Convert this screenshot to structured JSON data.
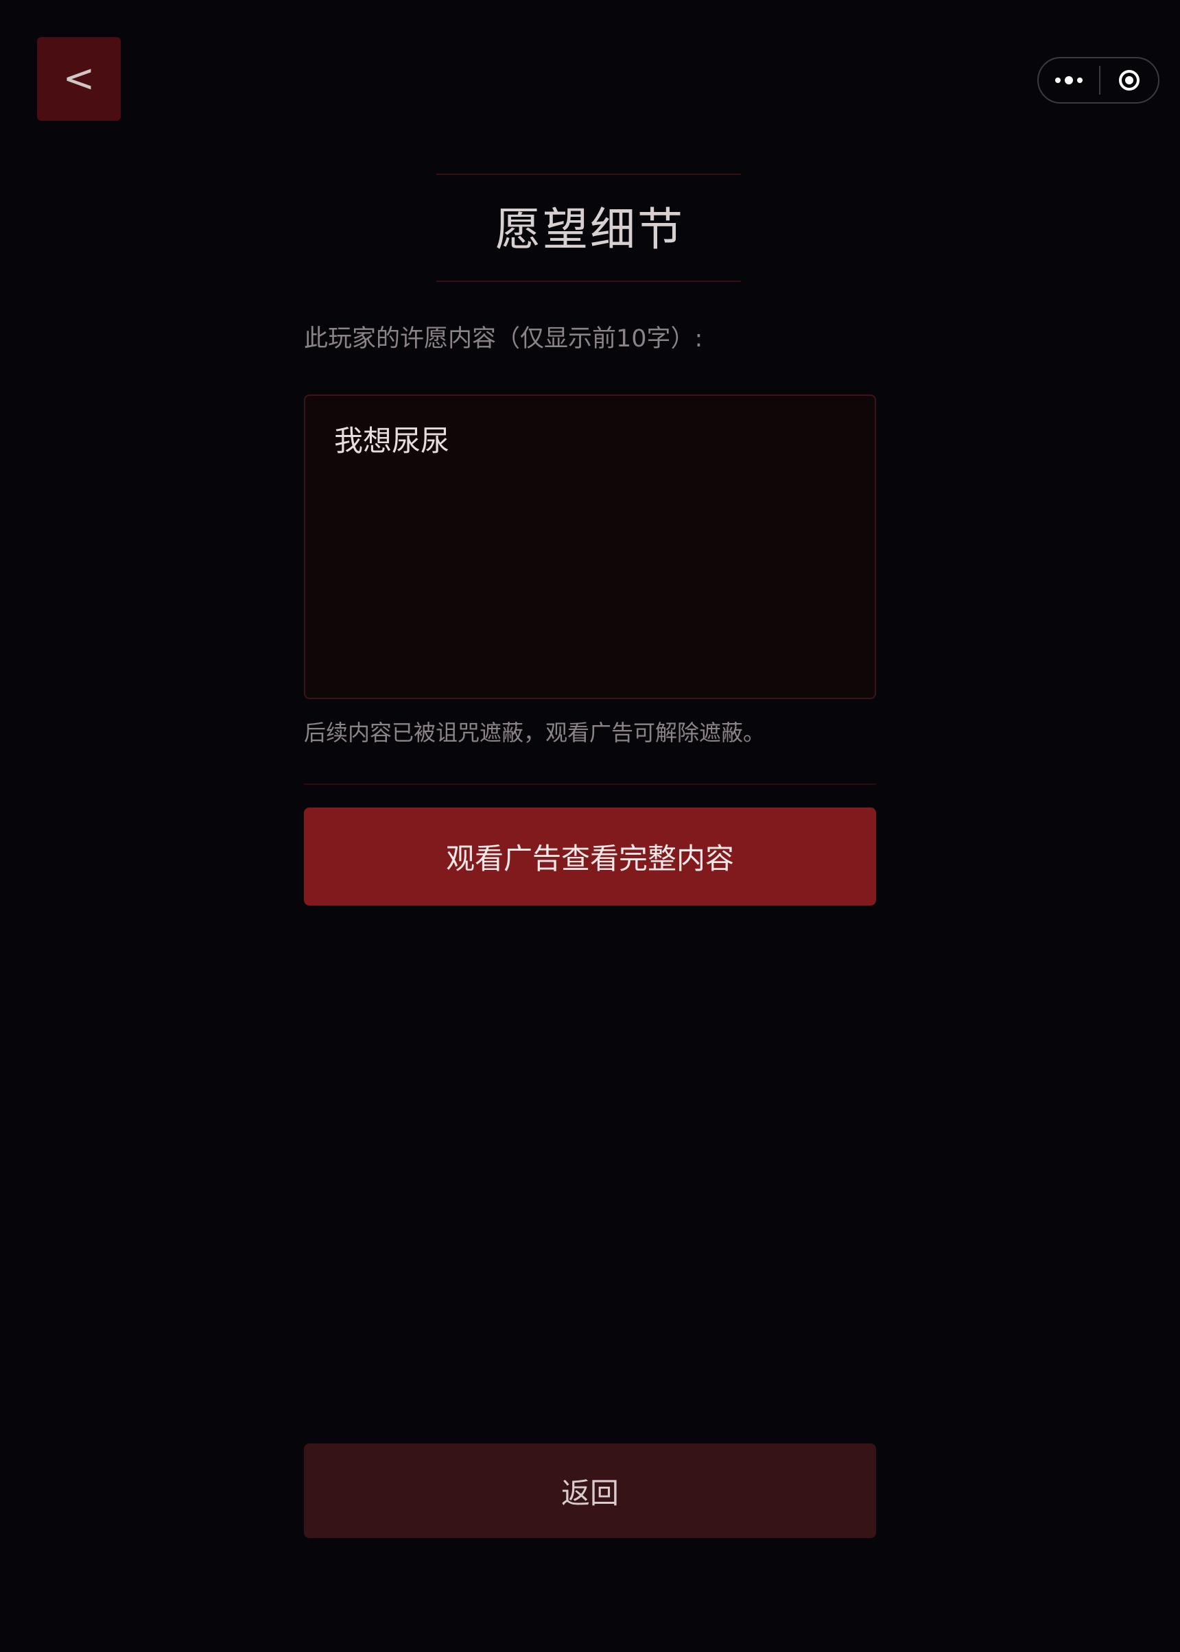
{
  "header": {
    "back_label": "<",
    "title": "愿望细节"
  },
  "capsule": {
    "more_icon": "more-dots-icon",
    "close_icon": "target-circle-icon"
  },
  "wish": {
    "label": "此玩家的许愿内容（仅显示前10字）:",
    "content": "我想尿尿",
    "note": "后续内容已被诅咒遮蔽，观看广告可解除遮蔽。"
  },
  "actions": {
    "watch_ad_label": "观看广告查看完整内容",
    "return_label": "返回"
  },
  "colors": {
    "background": "#05050a",
    "accent_red": "#801a1c",
    "back_button": "#4a0e12",
    "return_button": "#361416"
  }
}
